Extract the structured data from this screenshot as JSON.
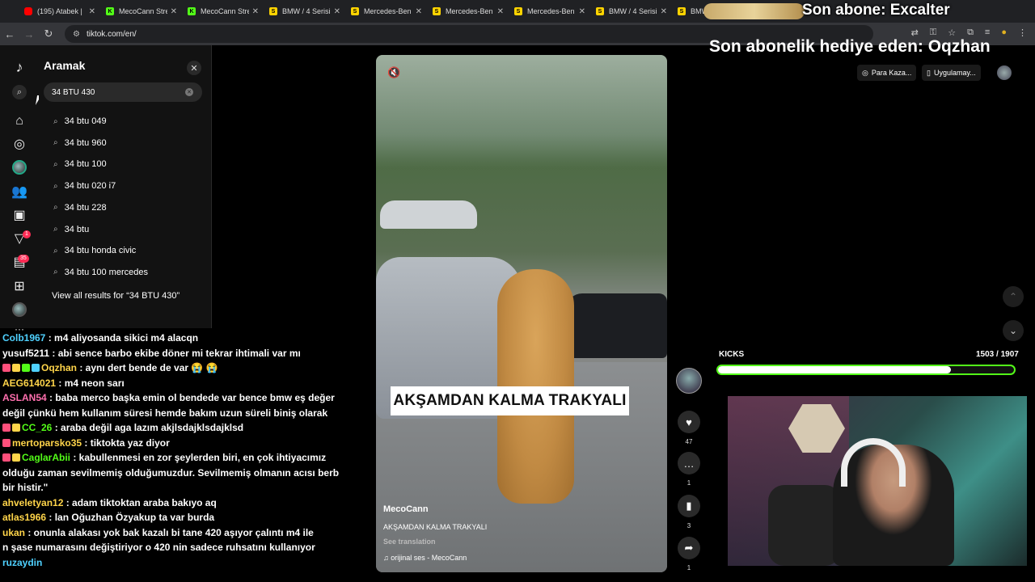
{
  "browser": {
    "tabs": [
      {
        "favicon": "youtube",
        "label": "(195) Atabek |"
      },
      {
        "favicon": "kick",
        "label": "MecoCann Stre"
      },
      {
        "favicon": "kick",
        "label": "MecoCann Stre"
      },
      {
        "favicon": "s",
        "label": "BMW / 4 Serisi"
      },
      {
        "favicon": "s",
        "label": "Mercedes-Ben"
      },
      {
        "favicon": "s",
        "label": "Mercedes-Ben"
      },
      {
        "favicon": "s",
        "label": "Mercedes-Ben"
      },
      {
        "favicon": "s",
        "label": "BMW / 4 Serisi"
      },
      {
        "favicon": "s",
        "label": "BMW"
      }
    ],
    "url": "tiktok.com/en/"
  },
  "overlay": {
    "last_sub": "Son abone: Excalter",
    "last_gift": "Son abonelik hediye eden: Oqzhan"
  },
  "tiktok": {
    "search_panel": {
      "title": "Aramak",
      "query": "34 BTU 430",
      "suggestions": [
        "34 btu 049",
        "34 btu 960",
        "34 btu 100",
        "34 btu 020 i7",
        "34 btu 228",
        "34 btu",
        "34 btu honda civic",
        "34 btu 100 mercedes"
      ],
      "view_all": "View all results for “34 BTU 430”"
    },
    "nav_badges": {
      "inbox": "1",
      "messages": "35"
    },
    "top_buttons": {
      "earn": "Para Kaza...",
      "app": "Uygulamay..."
    },
    "video": {
      "caption_overlay": "AKŞAMDAN KALMA TRAKYALI",
      "author": "MecoCann",
      "description": "AKŞAMDAN KALMA TRAKYALI",
      "see_translation": "See translation",
      "sound": "orijinal ses - MecoCann"
    },
    "actions": {
      "likes": "47",
      "comments": "1",
      "saves": "3",
      "shares": "1"
    }
  },
  "kicks": {
    "label": "KICKS",
    "count": "1503 / 1907",
    "progress": 0.788
  },
  "chat": [
    {
      "user": "Colb1967",
      "color": "#4fd1ff",
      "text": " : m4 aliyosanda sikici m4 alacqn",
      "icons": 0
    },
    {
      "user": "yusuf5211",
      "color": "#ffffff",
      "text": " : abi sence barbo ekibe döner mi tekrar ihtimali var mı",
      "icons": 0
    },
    {
      "user": "Oqzhan",
      "color": "#ffd54a",
      "text": " : aynı dert bende de var 😭 😭",
      "icons": 4
    },
    {
      "user": "AEG614021",
      "color": "#ffd54a",
      "text": " : m4 neon sarı",
      "icons": 0
    },
    {
      "user": "ASLAN54",
      "color": "#ff6fae",
      "text": " : baba merco başka emin ol bendede var bence bmw eş değer",
      "icons": 0
    },
    {
      "user": "",
      "color": "#ffffff",
      "text": "değil çünkü hem kullanım süresi hemde bakım uzun süreli biniş olarak",
      "icons": 0
    },
    {
      "user": "CC_26",
      "color": "#53fc18",
      "text": " : araba değil aga lazım akjlsdajklsdajklsd",
      "icons": 2
    },
    {
      "user": "mertoparsko35",
      "color": "#ffd54a",
      "text": " : tiktokta yaz diyor",
      "icons": 1
    },
    {
      "user": "CaglarAbii",
      "color": "#53fc18",
      "text": " : kabullenmesi en zor şeylerden biri, en çok ihtiyacımız",
      "icons": 2
    },
    {
      "user": "",
      "color": "#ffffff",
      "text": "olduğu zaman sevilmemiş olduğumuzdur. Sevilmemiş olmanın acısı berb",
      "icons": 0
    },
    {
      "user": "",
      "color": "#ffffff",
      "text": "bir histir.\"",
      "icons": 0
    },
    {
      "user": "ahveletyan12",
      "color": "#ffd54a",
      "text": " : adam tiktoktan araba bakıyo aq",
      "icons": 0
    },
    {
      "user": "atlas1966",
      "color": "#ffd54a",
      "text": " : lan Oğuzhan Özyakup ta var burda",
      "icons": 0
    },
    {
      "user": "ukan",
      "color": "#ffd54a",
      "text": " : onunla alakası yok bak kazalı bi tane 420 aşıyor çalıntı m4 ile",
      "icons": 0
    },
    {
      "user": "",
      "color": "#ffffff",
      "text": "n şase numarasını değiştiriyor o 420 nin sadece ruhsatını kullanıyor",
      "icons": 0
    },
    {
      "user": "ruzaydin",
      "color": "#4fd1ff",
      "text": "",
      "icons": 0
    }
  ]
}
